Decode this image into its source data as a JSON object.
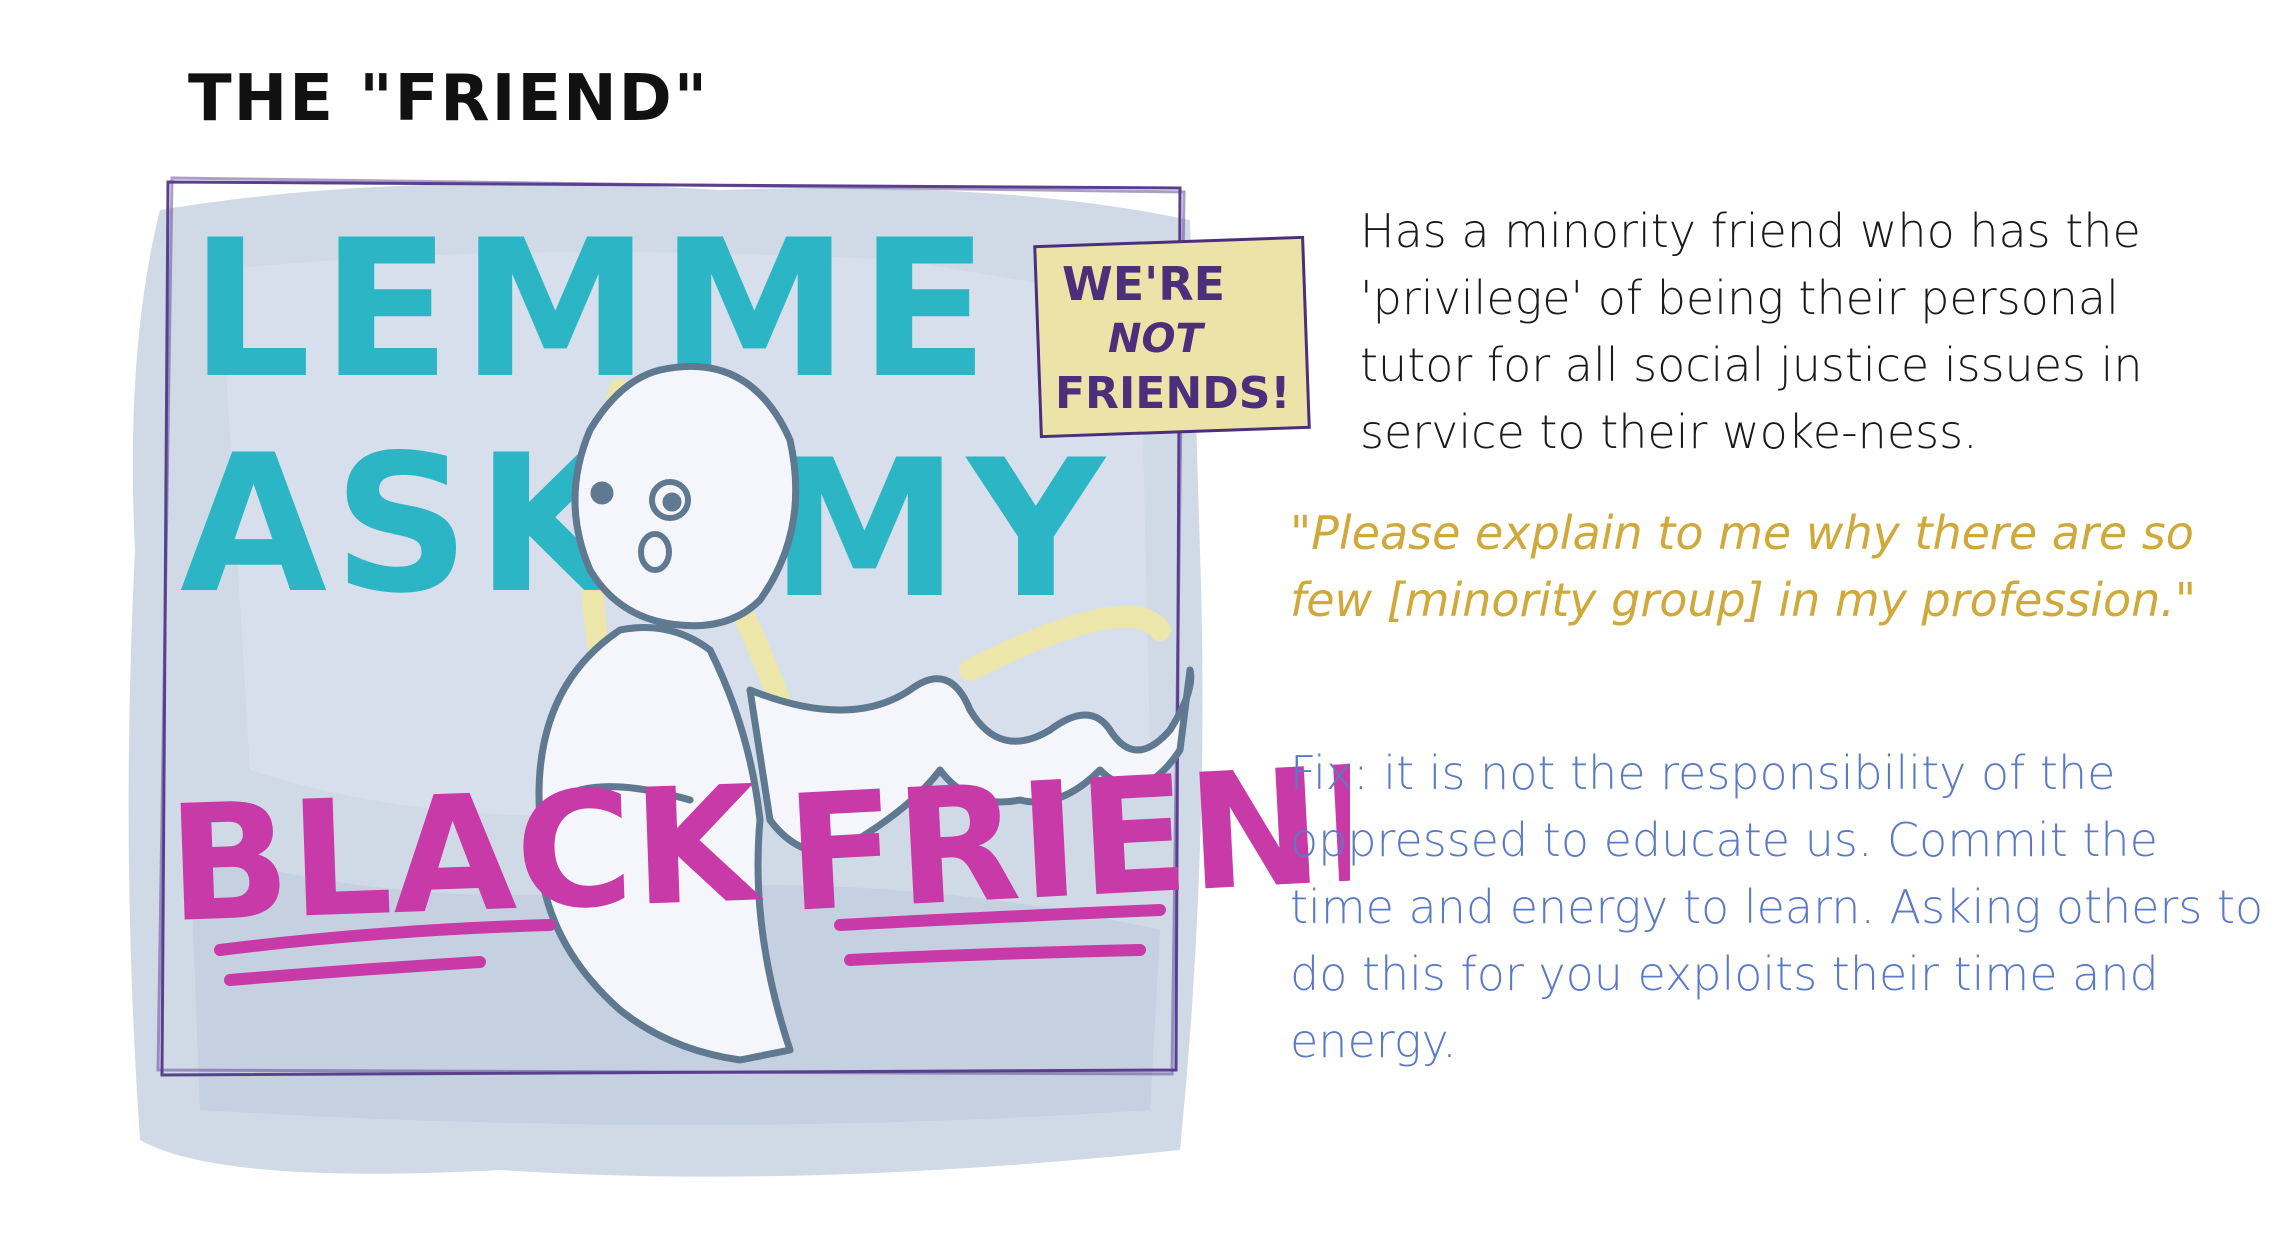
{
  "title": "THE \"FRIEND\"",
  "illustration": {
    "line_1": "LEMME",
    "line_2_left": "ASK",
    "line_2_right": "MY",
    "word_black": "BLACK",
    "word_friend": "FRIEND",
    "sign_lines": [
      "WE'RE",
      "NOT",
      "FRIENDS!"
    ],
    "colors": {
      "background_wash": "#c8d3e2",
      "frame": "#5a3f8f",
      "teal_text": "#2bb5c5",
      "magenta_text": "#c83aa8",
      "sign_fill": "#ece3a8",
      "sign_text": "#4b2f7a",
      "figure_outline": "#5f7990",
      "highlight_yellow": "#f0e8a0"
    }
  },
  "description": "Has a minority friend who has the 'privilege' of being their personal tutor for all social justice issues in service to their woke-ness.",
  "quote": "\"Please explain to me why there are so few [minority group] in my profession.\"",
  "fix": "Fix: it is not the responsibility of the oppressed to educate us. Commit the time and energy to learn. Asking others to do this for you exploits their time and energy.",
  "colors": {
    "description": "#1a1a1a",
    "quote": "#cfa93a",
    "fix": "#5b7ac6"
  }
}
